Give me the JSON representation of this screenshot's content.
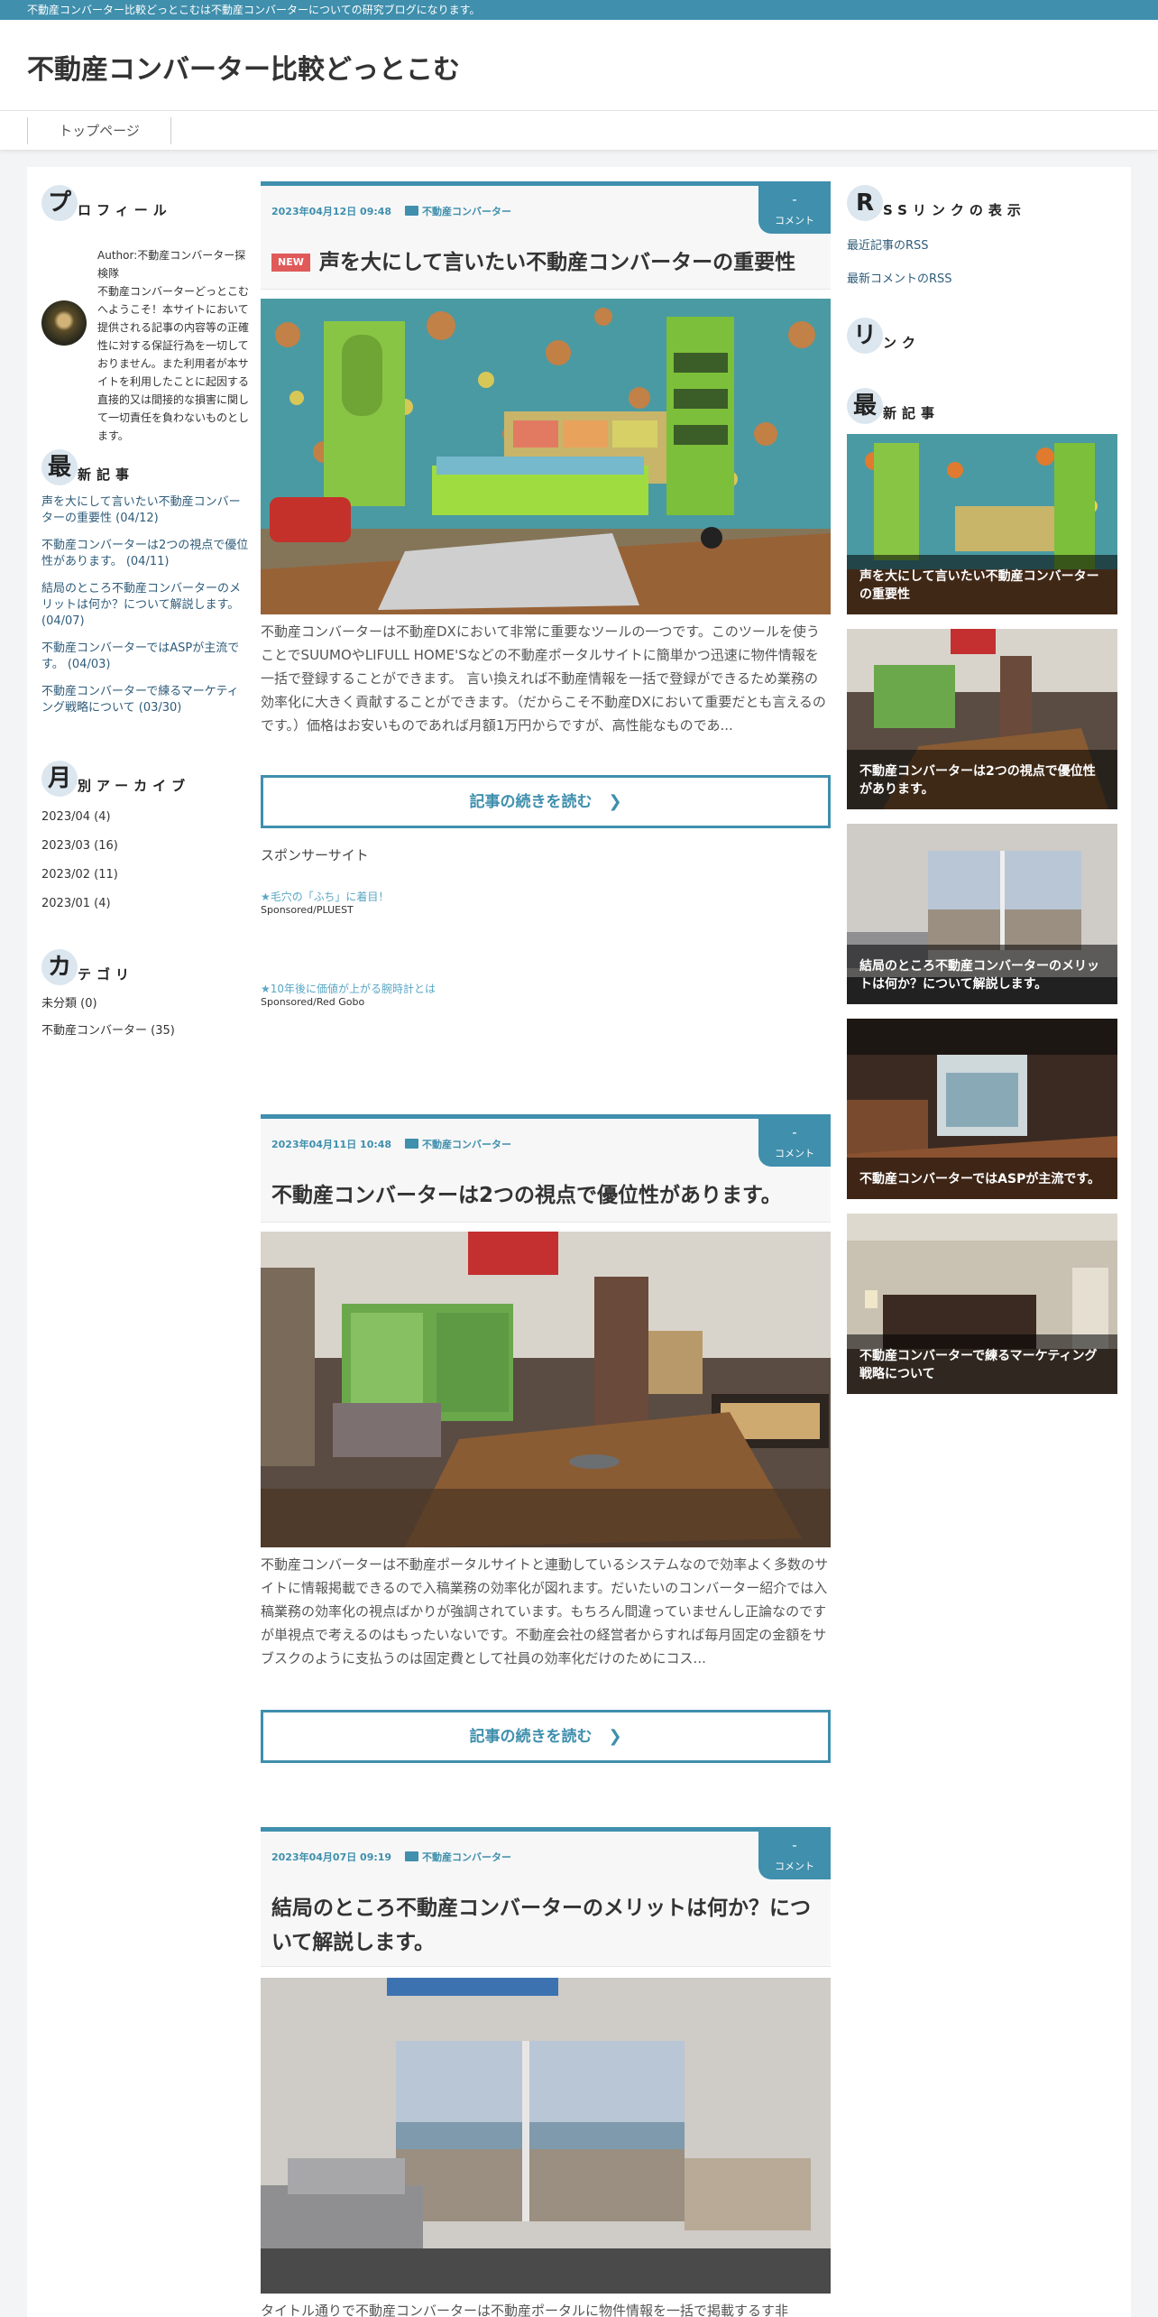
{
  "topbar": {
    "text": "不動産コンバーター比較どっとこむは不動産コンバーターについての研究ブログになります。"
  },
  "site": {
    "title": "不動産コンバーター比較どっとこむ"
  },
  "nav": {
    "items": [
      "トップページ"
    ]
  },
  "profile": {
    "heading_initial": "プ",
    "heading_rest": "ロフィール",
    "text": "Author:不動産コンバーター探検隊\n不動産コンバーターどっとこむへようこそ！本サイトにおいて提供される記事の内容等の正確性に対する保証行為を一切しておりません。また利用者が本サイトを利用したことに起因する直接的又は間接的な損害に関して一切責任を負わないものとします。"
  },
  "recent_left": {
    "heading_initial": "最",
    "heading_rest": "新記事",
    "items": [
      "声を大にして言いたい不動産コンバーターの重要性 (04/12)",
      "不動産コンバーターは2つの視点で優位性があります。 (04/11)",
      "結局のところ不動産コンバーターのメリットは何か？について解説します。 (04/07)",
      "不動産コンバーターではASPが主流です。 (04/03)",
      "不動産コンバーターで練るマーケティング戦略について (03/30)"
    ]
  },
  "archive": {
    "heading_initial": "月",
    "heading_rest": "別アーカイブ",
    "items": [
      "2023/04 (4)",
      "2023/03 (16)",
      "2023/02 (11)",
      "2023/01 (4)"
    ]
  },
  "category": {
    "heading_initial": "カ",
    "heading_rest": "テゴリ",
    "items": [
      "未分類 (0)",
      "不動産コンバーター (35)"
    ]
  },
  "posts": [
    {
      "date": "2023年04月12日 09:48",
      "category": "不動産コンバーター",
      "comment_count": "-",
      "comment_label": "コメント",
      "new_badge": "NEW",
      "title": "声を大にして言いたい不動産コンバーターの重要性",
      "excerpt": "不動産コンバーターは不動産DXにおいて非常に重要なツールの一つです。このツールを使うことでSUUMOやLIFULL HOME'Sなどの不動産ポータルサイトに簡単かつ迅速に物件情報を一括で登録することができます。 言い換えれば不動産情報を一括で登録ができるため業務の効率化に大きく貢献することができます。（だからこそ不動産DXにおいて重要だとも言えるのです。）価格はお安いものであれば月額1万円からですが、高性能なものであ...",
      "more": "記事の続きを読む"
    },
    {
      "date": "2023年04月11日 10:48",
      "category": "不動産コンバーター",
      "comment_count": "-",
      "comment_label": "コメント",
      "title": "不動産コンバーターは2つの視点で優位性があります。",
      "excerpt": "不動産コンバーターは不動産ポータルサイトと連動しているシステムなので効率よく多数のサイトに情報掲載できるので入稿業務の効率化が図れます。だいたいのコンバーター紹介では入稿業務の効率化の視点ばかりが強調されています。もちろん間違っていませんし正論なのですが単視点で考えるのはもったいないです。不動産会社の経営者からすれば毎月固定の金額をサブスクのように支払うのは固定費として社員の効率化だけのためにコス...",
      "more": "記事の続きを読む"
    },
    {
      "date": "2023年04月07日 09:19",
      "category": "不動産コンバーター",
      "comment_count": "-",
      "comment_label": "コメント",
      "title": "結局のところ不動産コンバーターのメリットは何か？について解説します。",
      "excerpt": "タイトル通りで不動産コンバーターは不動産ポータルに物件情報を一括で掲載するす非"
    }
  ],
  "sponsor": {
    "heading": "スポンサーサイト",
    "ads": [
      {
        "title": "★毛穴の「ふち」に着目！",
        "by": "Sponsored/PLUEST"
      },
      {
        "title": "★10年後に価値が上がる腕時計とは",
        "by": "Sponsored/Red Gobo"
      }
    ]
  },
  "rss": {
    "heading_initial": "R",
    "heading_rest": "SSリンクの表示",
    "links": [
      "最近記事のRSS",
      "最新コメントのRSS"
    ]
  },
  "links_widget": {
    "heading_initial": "リ",
    "heading_rest": "ンク"
  },
  "recent_right": {
    "heading_initial": "最",
    "heading_rest": "新記事",
    "cards": [
      "声を大にして言いたい不動産コンバーターの重要性",
      "不動産コンバーターは2つの視点で優位性があります。",
      "結局のところ不動産コンバーターのメリットは何か？について解説します。",
      "不動産コンバーターではASPが主流です。",
      "不動産コンバーターで練るマーケティング戦略について"
    ]
  },
  "colors": {
    "accent": "#3f8fad",
    "new_badge": "#e05a5a",
    "link": "#2f5c7a"
  }
}
